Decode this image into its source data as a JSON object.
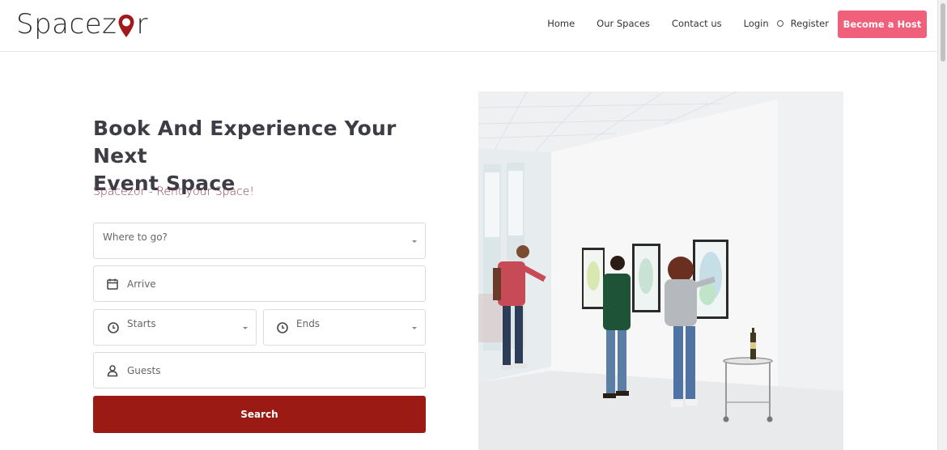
{
  "header": {
    "logo_text_before": "Spacez",
    "logo_text_after": "r",
    "nav": {
      "home": "Home",
      "our_spaces": "Our Spaces",
      "contact_us": "Contact us",
      "login": "Login",
      "register": "Register"
    },
    "become_host": "Become a Host",
    "brand_color": "#f0607a"
  },
  "hero": {
    "title_line1": "Book And Experience Your Next",
    "title_line2": "Event Space",
    "subtitle": "Spacezor - Rent your Space!"
  },
  "form": {
    "where_placeholder": "Where to go?",
    "arrive_placeholder": "Arrive",
    "starts_placeholder": "Starts",
    "ends_placeholder": "Ends",
    "guests_placeholder": "Guests",
    "search_label": "Search",
    "search_color": "#9b1a14"
  },
  "icons": {
    "logo_pin": "map-pin-icon",
    "arrive": "calendar-icon",
    "starts": "clock-icon",
    "ends": "clock-icon",
    "guests": "user-icon"
  }
}
